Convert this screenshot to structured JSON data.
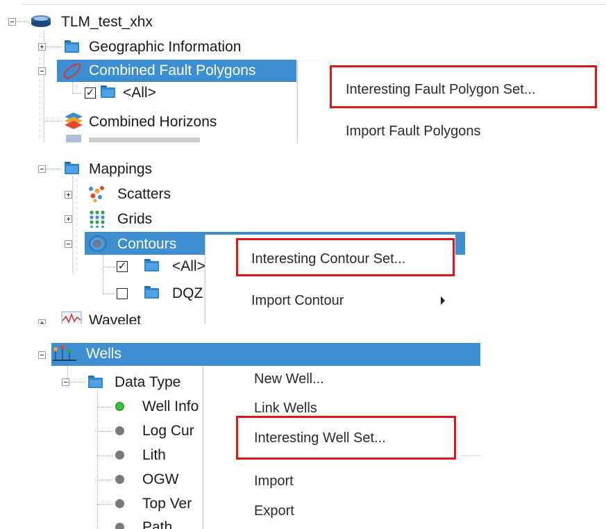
{
  "panel1": {
    "tree": {
      "root": "TLM_test_xhx",
      "geo": "Geographic Information",
      "fault": "Combined Fault Polygons",
      "all": "<All>",
      "horizons": "Combined Horizons"
    },
    "menu": {
      "item1": "Interesting Fault Polygon Set...",
      "item2": "Import Fault Polygons"
    }
  },
  "panel2": {
    "tree": {
      "mappings": "Mappings",
      "scatters": "Scatters",
      "grids": "Grids",
      "contours": "Contours",
      "all": "<All>",
      "dq": "DQZ",
      "wavelet": "Wavelet"
    },
    "menu": {
      "item1": "Interesting Contour Set...",
      "item2": "Import Contour"
    }
  },
  "panel3": {
    "tree": {
      "wells": "Wells",
      "datatype": "Data Type",
      "wellinfo": "Well Info",
      "logcurve": "Log Cur",
      "lith": "Lith",
      "ogw": "OGW",
      "topver": "Top Ver",
      "path": "Path"
    },
    "menu": {
      "item1": "New Well...",
      "item2": "Link Wells",
      "item3": "Interesting Well Set...",
      "item4": "Import",
      "item5": "Export"
    }
  },
  "colors": {
    "selection": "#3d8fd1",
    "highlight_box": "#e41414",
    "folder": "#2f86cf",
    "status_green": "#3ec23e",
    "status_gray": "#7a7a7a"
  }
}
